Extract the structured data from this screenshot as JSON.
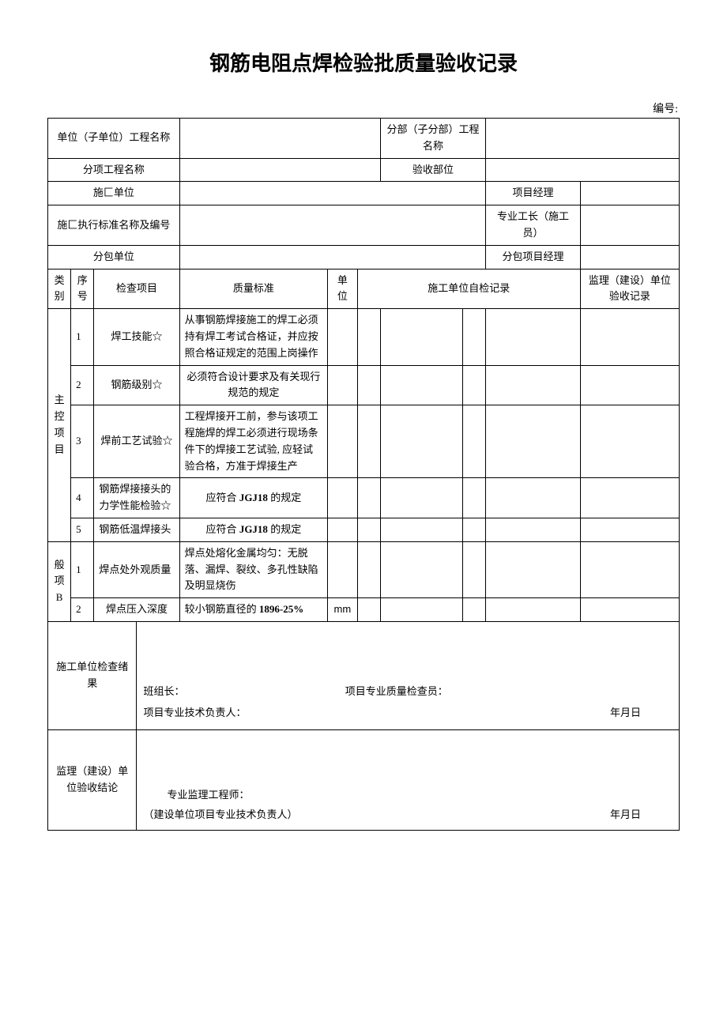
{
  "title": "钢筋电阻点焊检验批质量验收记录",
  "number_label": "编号:",
  "header": {
    "r1c1": "单位（子单位）工程名称",
    "r1c3": "分部（子分部）工程名称",
    "r2c1": "分项工程名称",
    "r2c3": "验收部位",
    "r3c1": "施匚单位",
    "r3c3": "项目经理",
    "r4c1": "施匚执行标准名称及编号",
    "r4c3": "专业工长（施工员）",
    "r5c1": "分包单位",
    "r5c3": "分包项目经理"
  },
  "columnHeaders": {
    "category": "类别",
    "index": "序号",
    "item": "检查项目",
    "standard": "质量标准",
    "unit": "单位",
    "selfCheck": "施工单位自检记录",
    "supervision": "监理（建设）单位验收记录"
  },
  "categoryMain": "主控项目",
  "categoryGeneral": "般项B",
  "mainItems": [
    {
      "idx": "1",
      "item": "焊工技能☆",
      "standard": "从事钢筋焊接施工的焊工必须持有焊工考试合格证，并应按照合格证规定的范围上岗操作",
      "unit": ""
    },
    {
      "idx": "2",
      "item": "钢筋级别☆",
      "standard": "必须符合设计要求及有关现行规范的规定",
      "unit": ""
    },
    {
      "idx": "3",
      "item": "焊前工艺试验☆",
      "standard": "工程焊接开工前，参与该项工程施焊的焊工必须进行现场条件下的焊接工艺试验, 应轻试验合格，方准于焊接生产",
      "unit": ""
    },
    {
      "idx": "4",
      "item": "钢筋焊接接头的力学性能检验☆",
      "standard_prefix": "应符合 ",
      "standard_bold": "JGJ18",
      "standard_suffix": " 的规定",
      "unit": ""
    },
    {
      "idx": "5",
      "item": "钢筋低温焊接头",
      "standard_prefix": "应符合 ",
      "standard_bold": "JGJ18",
      "standard_suffix": " 的规定",
      "unit": ""
    }
  ],
  "generalItems": [
    {
      "idx": "1",
      "item": "焊点处外观质量",
      "standard": "焊点处熔化金属均匀：无脱落、漏焊、裂纹、多孔性缺陷及明显烧伤",
      "unit": ""
    },
    {
      "idx": "2",
      "item": "焊点压入深度",
      "standard_prefix": "较小钢筋直径的 ",
      "standard_bold": "1896-25%",
      "standard_suffix": "",
      "unit": "mm"
    }
  ],
  "signoff": {
    "construction_label": "施工单位检查绪果",
    "team_leader": "班组长：",
    "quality_inspector": "项目专业质量检查员：",
    "tech_lead": "项目专业技术负责人：",
    "date": "年月日",
    "supervision_label": "监理（建设）单位验收结论",
    "engineer": "专业监理工程师：",
    "build_tech": "（建设单位项目专业技术负责人）"
  }
}
